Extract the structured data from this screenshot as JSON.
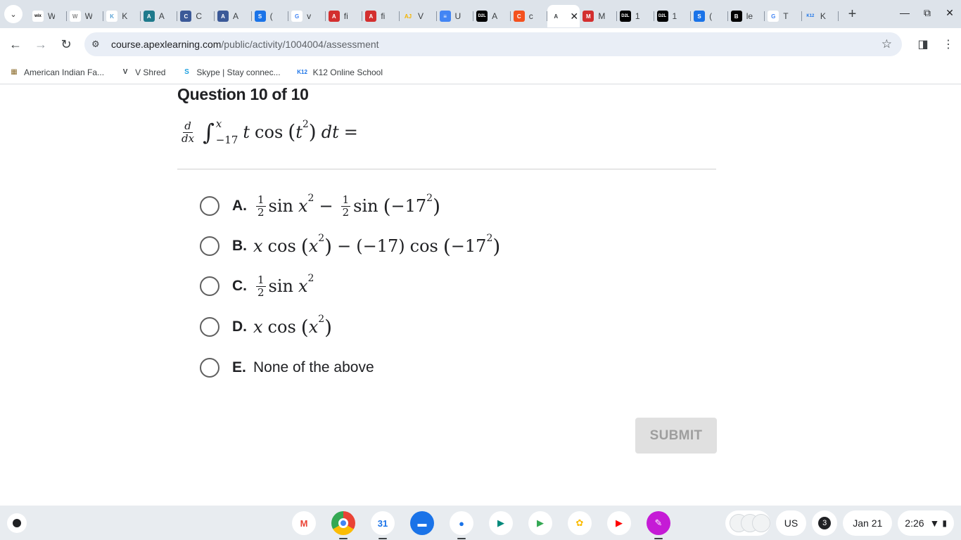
{
  "browser": {
    "tabs": [
      {
        "fav": "wix",
        "title": "W",
        "color": "#ffffff",
        "fg": "#000000"
      },
      {
        "fav": "W",
        "title": "W",
        "color": "#ffffff",
        "fg": "#8a8a8a"
      },
      {
        "fav": "K",
        "title": "K",
        "color": "#ffffff",
        "fg": "#5aa3d6"
      },
      {
        "fav": "A",
        "title": "A",
        "color": "#1f7a8c",
        "fg": "#ffffff"
      },
      {
        "fav": "C",
        "title": "C",
        "color": "#3b5998",
        "fg": "#ffffff"
      },
      {
        "fav": "A",
        "title": "A",
        "color": "#3b5998",
        "fg": "#ffffff"
      },
      {
        "fav": "S",
        "title": "(",
        "color": "#1a73e8",
        "fg": "#ffffff"
      },
      {
        "fav": "G",
        "title": "v",
        "color": "#ffffff",
        "fg": "#4285f4"
      },
      {
        "fav": "A",
        "title": "fi",
        "color": "#d32f2f",
        "fg": "#ffffff"
      },
      {
        "fav": "A",
        "title": "fi",
        "color": "#d32f2f",
        "fg": "#ffffff"
      },
      {
        "fav": "AJ",
        "title": "V",
        "color": "#dde3ea",
        "fg": "#f4b400"
      },
      {
        "fav": "≡",
        "title": "U",
        "color": "#4285f4",
        "fg": "#ffffff"
      },
      {
        "fav": "D2L",
        "title": "A",
        "color": "#000000",
        "fg": "#ffffff"
      },
      {
        "fav": "C",
        "title": "c",
        "color": "#f4511e",
        "fg": "#ffffff"
      },
      {
        "fav": "A",
        "title": "",
        "color": "#ffffff",
        "fg": "#3c4043",
        "active": true
      },
      {
        "fav": "M",
        "title": "M",
        "color": "#d32f2f",
        "fg": "#ffffff"
      },
      {
        "fav": "D2L",
        "title": "1",
        "color": "#000000",
        "fg": "#ffffff"
      },
      {
        "fav": "D2L",
        "title": "1",
        "color": "#000000",
        "fg": "#ffffff"
      },
      {
        "fav": "S",
        "title": "(",
        "color": "#1a73e8",
        "fg": "#ffffff"
      },
      {
        "fav": "B",
        "title": "le",
        "color": "#000000",
        "fg": "#ffffff"
      },
      {
        "fav": "G",
        "title": "T",
        "color": "#ffffff",
        "fg": "#4285f4"
      },
      {
        "fav": "K12",
        "title": "K",
        "color": "#dde3ea",
        "fg": "#1a73e8"
      }
    ],
    "url_host": "course.apexlearning.com",
    "url_path": "/public/activity/1004004/assessment",
    "bookmarks": [
      {
        "label": "American Indian Fa...",
        "fav": "▦",
        "color": "#8d6e2f"
      },
      {
        "label": "V Shred",
        "fav": "V",
        "color": "#3c4043"
      },
      {
        "label": "Skype | Stay connec...",
        "fav": "S",
        "color": "#1a9fe0"
      },
      {
        "label": "K12 Online School",
        "fav": "K12",
        "color": "#1a73e8"
      }
    ]
  },
  "question": {
    "title": "Question 10 of 10",
    "prompt": {
      "d": "d",
      "dx": "dx",
      "integral": "∫",
      "upper": "x",
      "lower": "−17",
      "body_t": "t",
      "cos": "cos",
      "lparen": "(",
      "t": "t",
      "t_exp": "2",
      "rparen": ")",
      "dt": "dt",
      "eq": "="
    },
    "choices": [
      {
        "letter": "A.",
        "kind": "a"
      },
      {
        "letter": "B.",
        "kind": "b"
      },
      {
        "letter": "C.",
        "kind": "c"
      },
      {
        "letter": "D.",
        "kind": "d"
      },
      {
        "letter": "E.",
        "kind": "e",
        "text": "None of the above"
      }
    ],
    "math": {
      "one": "1",
      "two": "2",
      "sin": "sin",
      "cos": "cos",
      "x": "x",
      "exp2": "2",
      "minus": "−",
      "neg17": "−17",
      "lp": "(",
      "rp": ")"
    },
    "submit_label": "SUBMIT"
  },
  "shelf": {
    "apps": [
      {
        "name": "gmail",
        "glyph": "M",
        "color": "#ffffff",
        "fg": "#ea4335"
      },
      {
        "name": "chrome",
        "glyph": "",
        "color": "#4285f4",
        "fg": "#ffffff",
        "running": true
      },
      {
        "name": "calendar",
        "glyph": "31",
        "color": "#ffffff",
        "fg": "#1a73e8",
        "running": true
      },
      {
        "name": "files",
        "glyph": "▬",
        "color": "#1a73e8",
        "fg": "#ffffff"
      },
      {
        "name": "messages",
        "glyph": "●",
        "color": "#ffffff",
        "fg": "#1a73e8",
        "running": true
      },
      {
        "name": "meet",
        "glyph": "▶",
        "color": "#ffffff",
        "fg": "#00897b"
      },
      {
        "name": "play",
        "glyph": "▶",
        "color": "#ffffff",
        "fg": "#34a853"
      },
      {
        "name": "photos",
        "glyph": "✿",
        "color": "#ffffff",
        "fg": "#fbbc04"
      },
      {
        "name": "youtube",
        "glyph": "▶",
        "color": "#ffffff",
        "fg": "#ff0000"
      },
      {
        "name": "canvas",
        "glyph": "✎",
        "color": "#c51bd6",
        "fg": "#ffffff",
        "running": true
      }
    ],
    "ime": "US",
    "notifications": "3",
    "date": "Jan 21",
    "time": "2:26"
  }
}
